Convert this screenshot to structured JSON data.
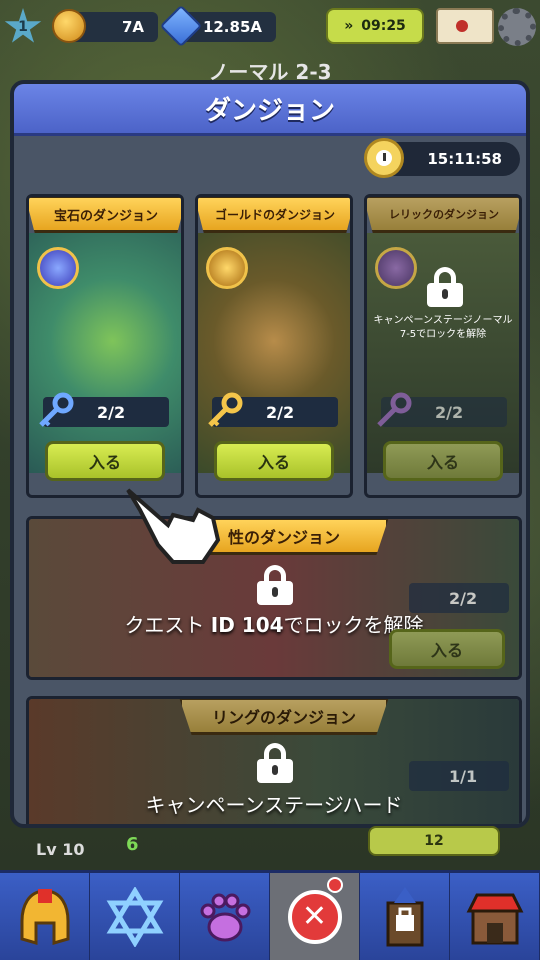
{
  "hud": {
    "level": "1",
    "gold": "7A",
    "gems": "12.85A",
    "boost_timer": "09:25"
  },
  "stage_title": "ノーマル 2-3",
  "modal": {
    "title": "ダンジョン",
    "timer": "15:11:58"
  },
  "dungeons": [
    {
      "title": "宝石のダンジョン",
      "count": "2/2",
      "enter_label": "入る",
      "locked": false
    },
    {
      "title": "ゴールドのダンジョン",
      "count": "2/2",
      "enter_label": "入る",
      "locked": false
    },
    {
      "title": "レリックのダンジョン",
      "count": "2/2",
      "enter_label": "入る",
      "locked": true,
      "lock_line1": "キャンペーンステージノーマル",
      "lock_line2": "7-5でロックを解除"
    }
  ],
  "attribute_dungeon": {
    "title": "性のダンジョン",
    "quest_prefix": "クエスト ",
    "quest_id": "ID 104",
    "quest_suffix": "でロックを解除",
    "count": "2/2",
    "enter_label": "入る"
  },
  "ring_dungeon": {
    "title": "リングのダンジョン",
    "count": "1/1",
    "lock_text": "キャンペーンステージハード"
  },
  "bottom_strip": {
    "level": "Lv 10",
    "value": "6",
    "pill_value": "12"
  },
  "colors": {
    "header_blue": "#5b74d8",
    "enter_green": "#c6dc4a",
    "banner_gold": "#f2bb3a",
    "close_red": "#e23a3a"
  }
}
